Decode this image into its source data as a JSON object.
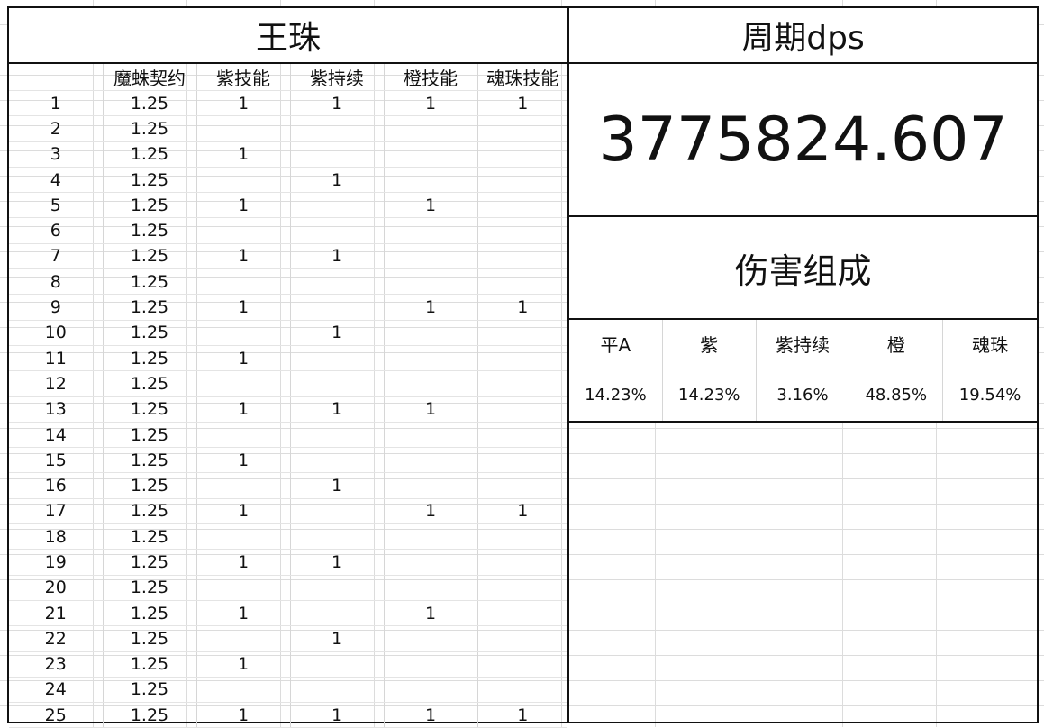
{
  "left": {
    "title": "王珠",
    "headers": [
      "",
      "魔蛛契约",
      "紫技能",
      "紫持续",
      "橙技能",
      "魂珠技能"
    ],
    "rows": [
      [
        "1",
        "1.25",
        "1",
        "1",
        "1",
        "1"
      ],
      [
        "2",
        "1.25",
        "",
        "",
        "",
        ""
      ],
      [
        "3",
        "1.25",
        "1",
        "",
        "",
        ""
      ],
      [
        "4",
        "1.25",
        "",
        "1",
        "",
        ""
      ],
      [
        "5",
        "1.25",
        "1",
        "",
        "1",
        ""
      ],
      [
        "6",
        "1.25",
        "",
        "",
        "",
        ""
      ],
      [
        "7",
        "1.25",
        "1",
        "1",
        "",
        ""
      ],
      [
        "8",
        "1.25",
        "",
        "",
        "",
        ""
      ],
      [
        "9",
        "1.25",
        "1",
        "",
        "1",
        "1"
      ],
      [
        "10",
        "1.25",
        "",
        "1",
        "",
        ""
      ],
      [
        "11",
        "1.25",
        "1",
        "",
        "",
        ""
      ],
      [
        "12",
        "1.25",
        "",
        "",
        "",
        ""
      ],
      [
        "13",
        "1.25",
        "1",
        "1",
        "1",
        ""
      ],
      [
        "14",
        "1.25",
        "",
        "",
        "",
        ""
      ],
      [
        "15",
        "1.25",
        "1",
        "",
        "",
        ""
      ],
      [
        "16",
        "1.25",
        "",
        "1",
        "",
        ""
      ],
      [
        "17",
        "1.25",
        "1",
        "",
        "1",
        "1"
      ],
      [
        "18",
        "1.25",
        "",
        "",
        "",
        ""
      ],
      [
        "19",
        "1.25",
        "1",
        "1",
        "",
        ""
      ],
      [
        "20",
        "1.25",
        "",
        "",
        "",
        ""
      ],
      [
        "21",
        "1.25",
        "1",
        "",
        "1",
        ""
      ],
      [
        "22",
        "1.25",
        "",
        "1",
        "",
        ""
      ],
      [
        "23",
        "1.25",
        "1",
        "",
        "",
        ""
      ],
      [
        "24",
        "1.25",
        "",
        "",
        "",
        ""
      ],
      [
        "25",
        "1.25",
        "1",
        "1",
        "1",
        "1"
      ]
    ]
  },
  "right": {
    "title": "周期dps",
    "dps_value": "3775824.607",
    "composition_title": "伤害组成",
    "composition": [
      {
        "label": "平A",
        "value": "14.23%"
      },
      {
        "label": "紫",
        "value": "14.23%"
      },
      {
        "label": "紫持续",
        "value": "3.16%"
      },
      {
        "label": "橙",
        "value": "48.85%"
      },
      {
        "label": "魂珠",
        "value": "19.54%"
      }
    ]
  }
}
